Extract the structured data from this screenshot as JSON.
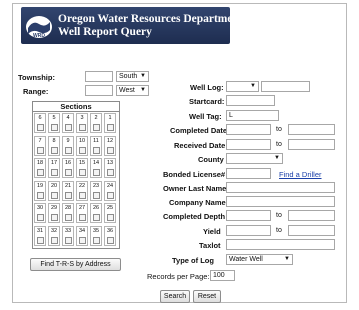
{
  "header": {
    "title": "Oregon Water Resources Department",
    "subtitle": "Well Report Query",
    "logo_text": "WRD"
  },
  "trs": {
    "township_label": "Township:",
    "township_value": "",
    "township_dir": "South",
    "range_label": "Range:",
    "range_value": "",
    "range_dir": "West"
  },
  "sections": {
    "title": "Sections",
    "rows": [
      [
        "6",
        "5",
        "4",
        "3",
        "2",
        "1"
      ],
      [
        "7",
        "8",
        "9",
        "10",
        "11",
        "12"
      ],
      [
        "18",
        "17",
        "16",
        "15",
        "14",
        "13"
      ],
      [
        "19",
        "20",
        "21",
        "22",
        "23",
        "24"
      ],
      [
        "30",
        "29",
        "28",
        "27",
        "26",
        "25"
      ],
      [
        "31",
        "32",
        "33",
        "34",
        "35",
        "36"
      ]
    ]
  },
  "find_trs_button": "Find T-R-S by Address",
  "form": {
    "well_log_label": "Well Log:",
    "well_log_select": "",
    "well_log_value": "",
    "startcard_label": "Startcard:",
    "well_tag_label": "Well Tag:",
    "well_tag_value": "L",
    "completed_date_label": "Completed Date",
    "received_date_label": "Received Date",
    "to_label": "to",
    "county_label": "County",
    "county_value": "",
    "bonded_label": "Bonded License#",
    "find_driller_link": "Find a Driller",
    "owner_label": "Owner Last Name",
    "company_label": "Company Name",
    "completed_depth_label": "Completed Depth",
    "yield_label": "Yield",
    "taxlot_label": "Taxlot",
    "type_of_log_label": "Type of Log",
    "type_of_log_value": "Water Well",
    "records_label": "Records per Page:",
    "records_value": "100"
  },
  "buttons": {
    "search": "Search",
    "reset": "Reset"
  },
  "colors": {
    "header_bg": "#27385e",
    "link": "#1a3fa8"
  }
}
